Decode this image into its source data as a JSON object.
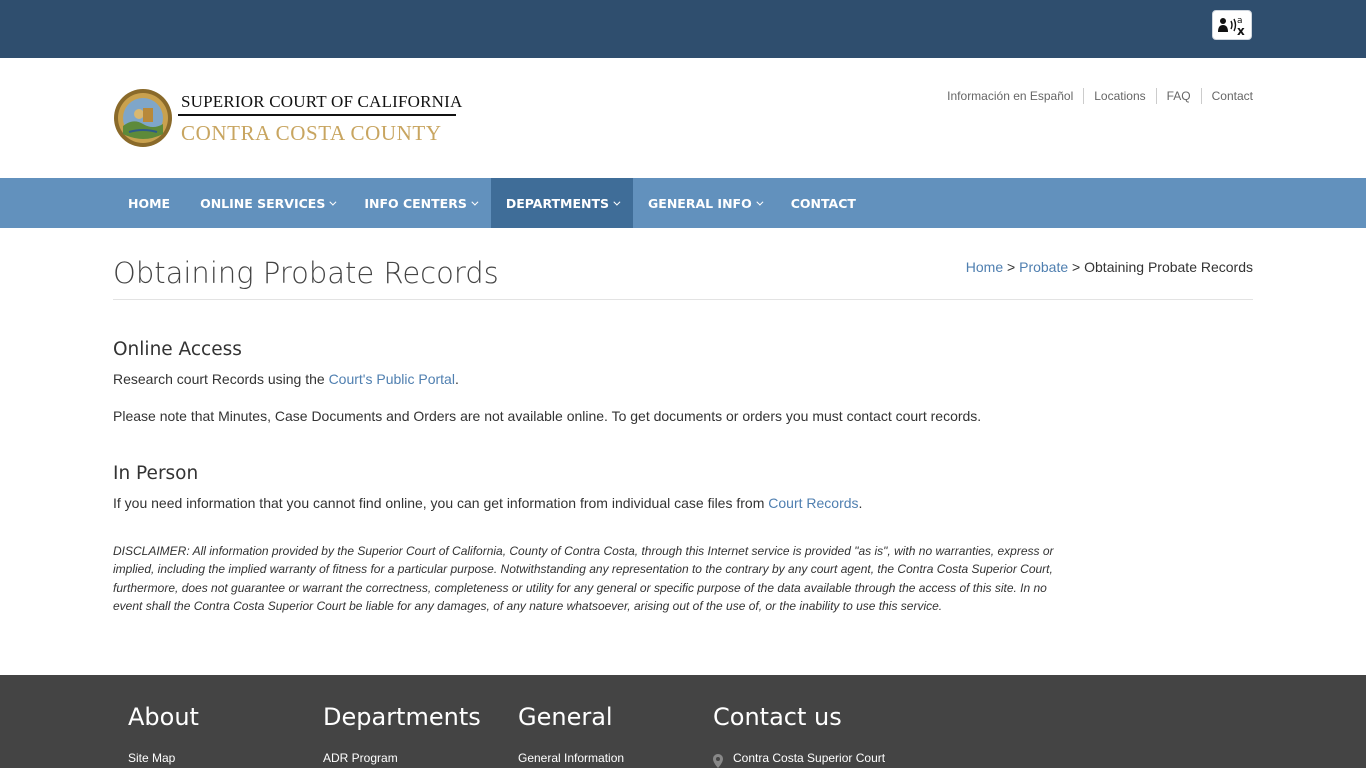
{
  "header": {
    "translate_icon": "translate-person-icon",
    "logo_line1": "SUPERIOR COURT OF CALIFORNIA",
    "logo_line2": "CONTRA COSTA COUNTY",
    "util_links": [
      "Información en Español",
      "Locations",
      "FAQ",
      "Contact"
    ]
  },
  "nav": {
    "items": [
      {
        "label": "HOME",
        "dropdown": false
      },
      {
        "label": "ONLINE SERVICES",
        "dropdown": true
      },
      {
        "label": "INFO CENTERS",
        "dropdown": true
      },
      {
        "label": "DEPARTMENTS",
        "dropdown": true,
        "active": true
      },
      {
        "label": "GENERAL INFO",
        "dropdown": true
      },
      {
        "label": "CONTACT",
        "dropdown": false
      }
    ]
  },
  "page": {
    "title": "Obtaining Probate Records",
    "breadcrumb": {
      "home": "Home",
      "sep1": " > ",
      "section": "Probate",
      "sep2": " > ",
      "current": "Obtaining Probate Records"
    }
  },
  "online_access": {
    "heading": "Online Access",
    "p1_text": "Research court Records using the ",
    "p1_link": "Court's Public Portal",
    "p1_end": ".",
    "p2": "Please note that Minutes, Case Documents and Orders are not available online. To get documents or orders you must contact court records."
  },
  "in_person": {
    "heading": "In Person",
    "p1_text": "If you need information that you cannot find online, you can get information from individual case files from ",
    "p1_link": "Court Records",
    "p1_end": "."
  },
  "disclaimer": "DISCLAIMER: All information provided by the Superior Court of California, County of Contra Costa, through this Internet service is provided \"as is\", with no warranties, express or implied, including the implied warranty of fitness for a particular purpose. Notwithstanding any representation to the contrary by any court agent, the Contra Costa Superior Court, furthermore, does not guarantee or warrant the correctness, completeness or utility for any general or specific purpose of the data available through the access of this site. In no event shall the Contra Costa Superior Court be liable for any damages, of any nature whatsoever, arising out of the use of, or the inability to use this service.",
  "footer": {
    "about": {
      "heading": "About",
      "first_link": "Site Map"
    },
    "departments": {
      "heading": "Departments",
      "first_link": "ADR Program"
    },
    "general": {
      "heading": "General",
      "first_link": "General Information"
    },
    "contact": {
      "heading": "Contact us",
      "first_line": "Contra Costa Superior Court",
      "icon": "map-pin-icon"
    }
  },
  "colors": {
    "topbar": "#2f4e6e",
    "navbar": "#6291bd",
    "nav_active": "#3f6d98",
    "link": "#4f7fb0",
    "footer": "#444444",
    "logo_gold": "#c8a560"
  }
}
